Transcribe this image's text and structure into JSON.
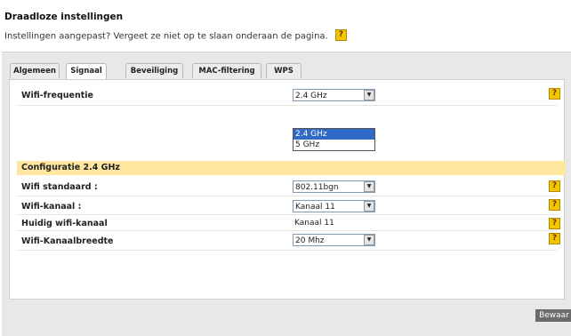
{
  "page": {
    "title": "Draadloze instellingen",
    "subtitle": "Instellingen aangepast? Vergeet ze niet op te slaan onderaan de pagina.",
    "help_glyph": "?"
  },
  "tabs": [
    {
      "label": "Algemeen",
      "active": false
    },
    {
      "label": "Signaal",
      "active": true
    },
    {
      "label": "Beveiliging",
      "active": false
    },
    {
      "label": "MAC-filtering",
      "active": false
    },
    {
      "label": "WPS",
      "active": false
    }
  ],
  "frequency": {
    "label": "Wifi-frequentie",
    "value": "2.4 GHz",
    "options": [
      "2.4 GHz",
      "5 GHz"
    ],
    "highlighted_option": "2.4 GHz"
  },
  "section": {
    "title": "Configuratie 2.4 GHz"
  },
  "settings": [
    {
      "label": "Wifi standaard :",
      "value": "802.11bgn",
      "kind": "select"
    },
    {
      "label": "Wifi-kanaal :",
      "value": "Kanaal 11",
      "kind": "select"
    },
    {
      "label": "Huidig wifi-kanaal",
      "value": "Kanaal 11",
      "kind": "text"
    },
    {
      "label": "Wifi-Kanaalbreedte",
      "value": "20 Mhz",
      "kind": "select"
    }
  ],
  "actions": {
    "save_label": "Bewaar"
  },
  "colors": {
    "section_bg": "#ffe7a0",
    "help_bg": "#f4c400",
    "selected_option": "#3169c6",
    "save_bg": "#6b6b6b"
  },
  "icons": {
    "help": "help-icon",
    "dropdown_arrow": "chevron-down-icon"
  }
}
